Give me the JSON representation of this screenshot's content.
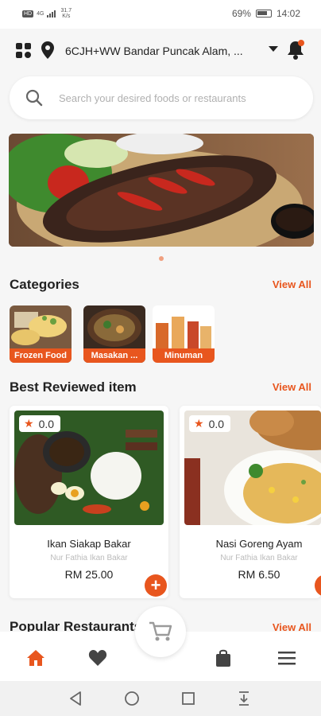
{
  "status": {
    "carrier": "HD",
    "network": "4G",
    "speed_value": "31.7",
    "speed_unit": "K/s",
    "battery": "69%",
    "time": "14:02"
  },
  "header": {
    "address": "6CJH+WW Bandar Puncak Alam, ...",
    "search_placeholder": "Search your desired foods or restaurants"
  },
  "categories": {
    "title": "Categories",
    "view_all": "View All",
    "items": [
      {
        "label": "Frozen Food"
      },
      {
        "label": "Masakan ..."
      },
      {
        "label": "Minuman"
      }
    ]
  },
  "best_reviewed": {
    "title": "Best Reviewed item",
    "view_all": "View All",
    "items": [
      {
        "rating": "0.0",
        "name": "Ikan Siakap Bakar",
        "restaurant": "Nur Fathia Ikan Bakar",
        "price": "RM 25.00"
      },
      {
        "rating": "0.0",
        "name": "Nasi Goreng Ayam",
        "restaurant": "Nur Fathia Ikan Bakar",
        "price": "RM 6.50"
      }
    ]
  },
  "popular": {
    "title": "Popular Restaurants",
    "view_all": "View All"
  },
  "colors": {
    "accent": "#e8561e",
    "background": "#f6f6f6"
  },
  "icons": [
    "grid-icon",
    "location-pin-icon",
    "chevron-down-icon",
    "bell-icon",
    "search-icon",
    "star-icon",
    "plus-icon",
    "home-icon",
    "heart-icon",
    "cart-icon",
    "bag-icon",
    "menu-icon",
    "back-icon",
    "home-circle-icon",
    "recents-icon",
    "notification-pull-icon"
  ]
}
